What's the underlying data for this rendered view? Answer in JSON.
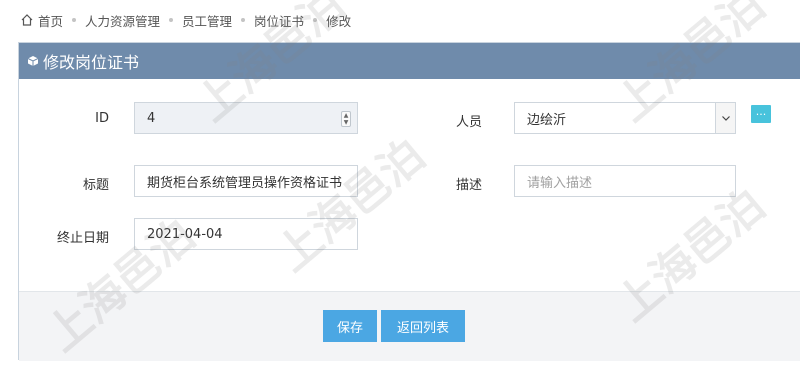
{
  "breadcrumb": {
    "items": [
      "首页",
      "人力资源管理",
      "员工管理",
      "岗位证书",
      "修改"
    ]
  },
  "panel": {
    "title": "修改岗位证书"
  },
  "form": {
    "id_label": "ID",
    "id_value": "4",
    "person_label": "人员",
    "person_value": "边绘沂",
    "more_label": "...",
    "title_label": "标题",
    "title_value": "期货柜台系统管理员操作资格证书",
    "desc_label": "描述",
    "desc_placeholder": "请输入描述",
    "end_date_label": "终止日期",
    "end_date_value": "2021-04-04"
  },
  "buttons": {
    "save": "保存",
    "back": "返回列表"
  },
  "watermark": "上海邑泊",
  "colors": {
    "header": "#6f8bab",
    "button": "#4ba7e3",
    "more_button": "#48c3dc"
  }
}
